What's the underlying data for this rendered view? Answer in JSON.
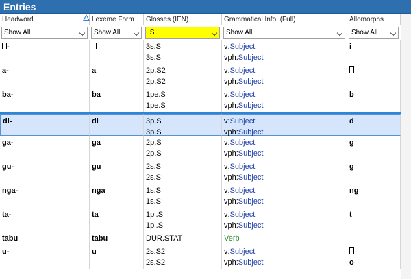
{
  "window": {
    "title": "Entries"
  },
  "columns": [
    "Headword",
    "Lexeme Form",
    "Glosses (IEN)",
    "Grammatical Info. (Full)",
    "Allomorphs"
  ],
  "filters": [
    "Show All",
    "Show All",
    ".S",
    "Show All",
    "Show All"
  ],
  "rows": [
    {
      "headword": "□-",
      "lexeme": "□",
      "glosses": [
        "3s.S",
        "3s.S"
      ],
      "gram": [
        [
          "v:",
          "Subject"
        ],
        [
          "vph:",
          "Subject"
        ]
      ],
      "allo": [
        "i"
      ]
    },
    {
      "headword": "a-",
      "lexeme": "a",
      "glosses": [
        "2p.S2",
        "2p.S2"
      ],
      "gram": [
        [
          "v:",
          "Subject"
        ],
        [
          "vph:",
          "Subject"
        ]
      ],
      "allo": [
        "□"
      ]
    },
    {
      "headword": "ba-",
      "lexeme": "ba",
      "glosses": [
        "1pe.S",
        "1pe.S"
      ],
      "gram": [
        [
          "v:",
          "Subject"
        ],
        [
          "vph:",
          "Subject"
        ]
      ],
      "allo": [
        "b"
      ]
    },
    {
      "headword": "di-",
      "lexeme": "di",
      "glosses": [
        "3p.S",
        "3p.S"
      ],
      "gram": [
        [
          "v:",
          "Subject"
        ],
        [
          "vph:",
          "Subject"
        ]
      ],
      "allo": [
        "d"
      ],
      "selected": true
    },
    {
      "headword": "ga-",
      "lexeme": "ga",
      "glosses": [
        "2p.S",
        "2p.S"
      ],
      "gram": [
        [
          "v:",
          "Subject"
        ],
        [
          "vph:",
          "Subject"
        ]
      ],
      "allo": [
        "g"
      ]
    },
    {
      "headword": "gu-",
      "lexeme": "gu",
      "glosses": [
        "2s.S",
        "2s.S"
      ],
      "gram": [
        [
          "v:",
          "Subject"
        ],
        [
          "vph:",
          "Subject"
        ]
      ],
      "allo": [
        "g"
      ]
    },
    {
      "headword": "nga-",
      "lexeme": "nga",
      "glosses": [
        "1s.S",
        "1s.S"
      ],
      "gram": [
        [
          "v:",
          "Subject"
        ],
        [
          "vph:",
          "Subject"
        ]
      ],
      "allo": [
        "ng"
      ]
    },
    {
      "headword": "ta-",
      "lexeme": "ta",
      "glosses": [
        "1pi.S",
        "1pi.S"
      ],
      "gram": [
        [
          "v:",
          "Subject"
        ],
        [
          "vph:",
          "Subject"
        ]
      ],
      "allo": [
        "t"
      ]
    },
    {
      "headword": "tabu",
      "lexeme": "tabu",
      "glosses": [
        "DUR.STAT"
      ],
      "gram": [
        [
          "",
          "Verb"
        ]
      ],
      "allo": [],
      "single": true,
      "gramColor": "green"
    },
    {
      "headword": "u-",
      "lexeme": "u",
      "glosses": [
        "2s.S2",
        "2s.S2"
      ],
      "gram": [
        [
          "v:",
          "Subject"
        ],
        [
          "vph:",
          "Subject"
        ]
      ],
      "allo": [
        "□",
        "o"
      ]
    }
  ],
  "colors": {
    "title_bar": "#2e6fb0",
    "filter_highlight": "#ffff00",
    "selected_row": "#d5e5fb",
    "link": "#1f3fa8",
    "pos_green": "#2e8b2e"
  },
  "icons": {
    "sort": "sort-triangle-icon",
    "dropdown": "chevron-down-icon"
  }
}
